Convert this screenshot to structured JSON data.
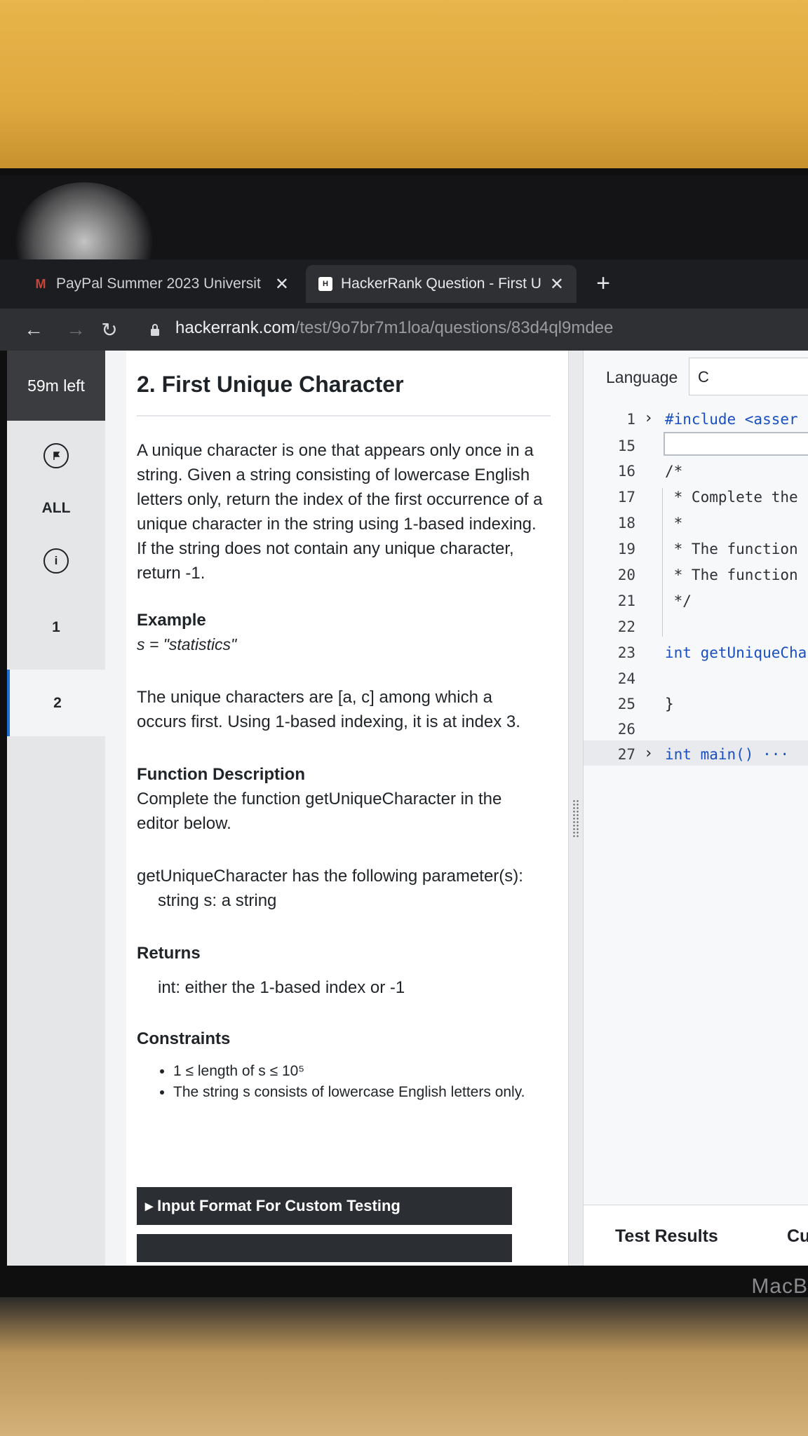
{
  "browser": {
    "tabs": [
      {
        "title": "PayPal Summer 2023 Universit",
        "favicon": "gmail-icon",
        "active": false
      },
      {
        "title": "HackerRank Question - First U",
        "favicon": "hackerrank-icon",
        "active": true
      }
    ],
    "url_host": "hackerrank.com",
    "url_path": "/test/9o7br7m1loa/questions/83d4ql9mdee"
  },
  "sidebar": {
    "timer": "59m left",
    "items": [
      {
        "label": "",
        "icon": "flag-icon"
      },
      {
        "label": "ALL"
      },
      {
        "label": "",
        "icon": "info-icon",
        "icon_glyph": "i"
      },
      {
        "label": "1"
      },
      {
        "label": "2",
        "current": true
      }
    ]
  },
  "problem": {
    "title": "2. First Unique Character",
    "description": "A unique character is one that appears only once in a string. Given a string consisting of lowercase English letters only, return the index of the first occurrence of a unique character in the string using 1-based indexing. If the string does not contain any unique character, return -1.",
    "example_heading": "Example",
    "example_input": "s = \"statistics\"",
    "example_explanation": "The unique characters are [a, c] among which a occurs first. Using 1-based indexing, it is at index 3.",
    "function_heading": "Function Description",
    "function_text": "Complete the function getUniqueCharacter in the editor below.",
    "params_intro": "getUniqueCharacter has the following parameter(s):",
    "param": "string s: a string",
    "returns_heading": "Returns",
    "returns_text": "int: either the 1-based index or -1",
    "constraints_heading": "Constraints",
    "constraints": [
      "1 ≤ length of s ≤ 10⁵",
      "The string s consists of lowercase English letters only."
    ],
    "accordion_label": "▸ Input Format For Custom Testing"
  },
  "editor": {
    "language_label": "Language",
    "language_value": "C",
    "lines": [
      {
        "num": "1",
        "fold": "›",
        "text": "#include <asser"
      },
      {
        "num": "15",
        "text": ""
      },
      {
        "num": "16",
        "text": "/*"
      },
      {
        "num": "17",
        "text": " * Complete the"
      },
      {
        "num": "18",
        "text": " *"
      },
      {
        "num": "19",
        "text": " * The function"
      },
      {
        "num": "20",
        "text": " * The function"
      },
      {
        "num": "21",
        "text": " */"
      },
      {
        "num": "22",
        "text": ""
      },
      {
        "num": "23",
        "text": "int getUniqueCha"
      },
      {
        "num": "24",
        "text": ""
      },
      {
        "num": "25",
        "text": "}"
      },
      {
        "num": "26",
        "text": ""
      },
      {
        "num": "27",
        "fold": "›",
        "text": "int main() ···"
      }
    ],
    "result_tabs": [
      "Test Results",
      "Cu"
    ]
  },
  "laptop_brand": "MacB"
}
